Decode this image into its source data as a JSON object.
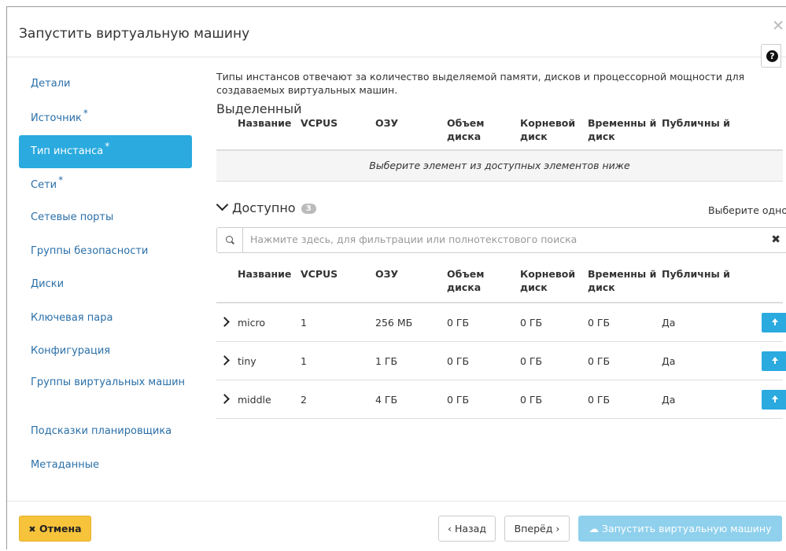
{
  "dialog": {
    "title": "Запустить виртуальную машину",
    "close_symbol": "✕",
    "help_symbol": "?"
  },
  "nav": {
    "items": [
      {
        "label": "Детали",
        "required": false,
        "active": false
      },
      {
        "label": "Источник",
        "required": true,
        "active": false
      },
      {
        "label": "Тип инстанса",
        "required": true,
        "active": true
      },
      {
        "label": "Сети",
        "required": true,
        "active": false
      },
      {
        "label": "Сетевые порты",
        "required": false,
        "active": false
      },
      {
        "label": "Группы безопасности",
        "required": false,
        "active": false
      },
      {
        "label": "Диски",
        "required": false,
        "active": false
      },
      {
        "label": "Ключевая пара",
        "required": false,
        "active": false
      },
      {
        "label": "Конфигурация",
        "required": false,
        "active": false
      },
      {
        "label": "Группы виртуальных машин",
        "required": false,
        "active": false
      },
      {
        "label": "Подсказки планировщика",
        "required": false,
        "active": false
      },
      {
        "label": "Метаданные",
        "required": false,
        "active": false
      }
    ],
    "required_marker": "*"
  },
  "content": {
    "description": "Типы инстансов отвечают за количество выделяемой памяти, дисков и процессорной мощности для создаваемых виртуальных машин.",
    "allocated": {
      "title": "Выделенный",
      "empty_message": "Выберите элемент из доступных элементов ниже"
    },
    "columns": [
      "Название",
      "VCPUS",
      "ОЗУ",
      "Объем диска",
      "Корневой диск",
      "Временны й диск",
      "Публичны й"
    ],
    "available": {
      "title": "Доступно",
      "count": "3",
      "pick_hint": "Выберите одно",
      "search_placeholder": "Нажмите здесь, для фильтрации или полнотекстового поиска",
      "clear_symbol": "✖",
      "rows": [
        {
          "name": "micro",
          "vcpus": "1",
          "ram": "256 МБ",
          "disk": "0 ГБ",
          "root": "0 ГБ",
          "ephemeral": "0 ГБ",
          "public": "Да"
        },
        {
          "name": "tiny",
          "vcpus": "1",
          "ram": "1 ГБ",
          "disk": "0 ГБ",
          "root": "0 ГБ",
          "ephemeral": "0 ГБ",
          "public": "Да"
        },
        {
          "name": "middle",
          "vcpus": "2",
          "ram": "4 ГБ",
          "disk": "0 ГБ",
          "root": "0 ГБ",
          "ephemeral": "0 ГБ",
          "public": "Да"
        }
      ]
    }
  },
  "footer": {
    "cancel_icon": "✖",
    "cancel_label": "Отмена",
    "back_label": "‹ Назад",
    "next_label": "Вперёд ›",
    "launch_icon": "☁",
    "launch_label": "Запустить виртуальную машину"
  },
  "colors": {
    "accent": "#2aaadf",
    "cancel": "#f6c33b",
    "launch_disabled": "#8fd0ec",
    "link": "#2a6fa8"
  }
}
